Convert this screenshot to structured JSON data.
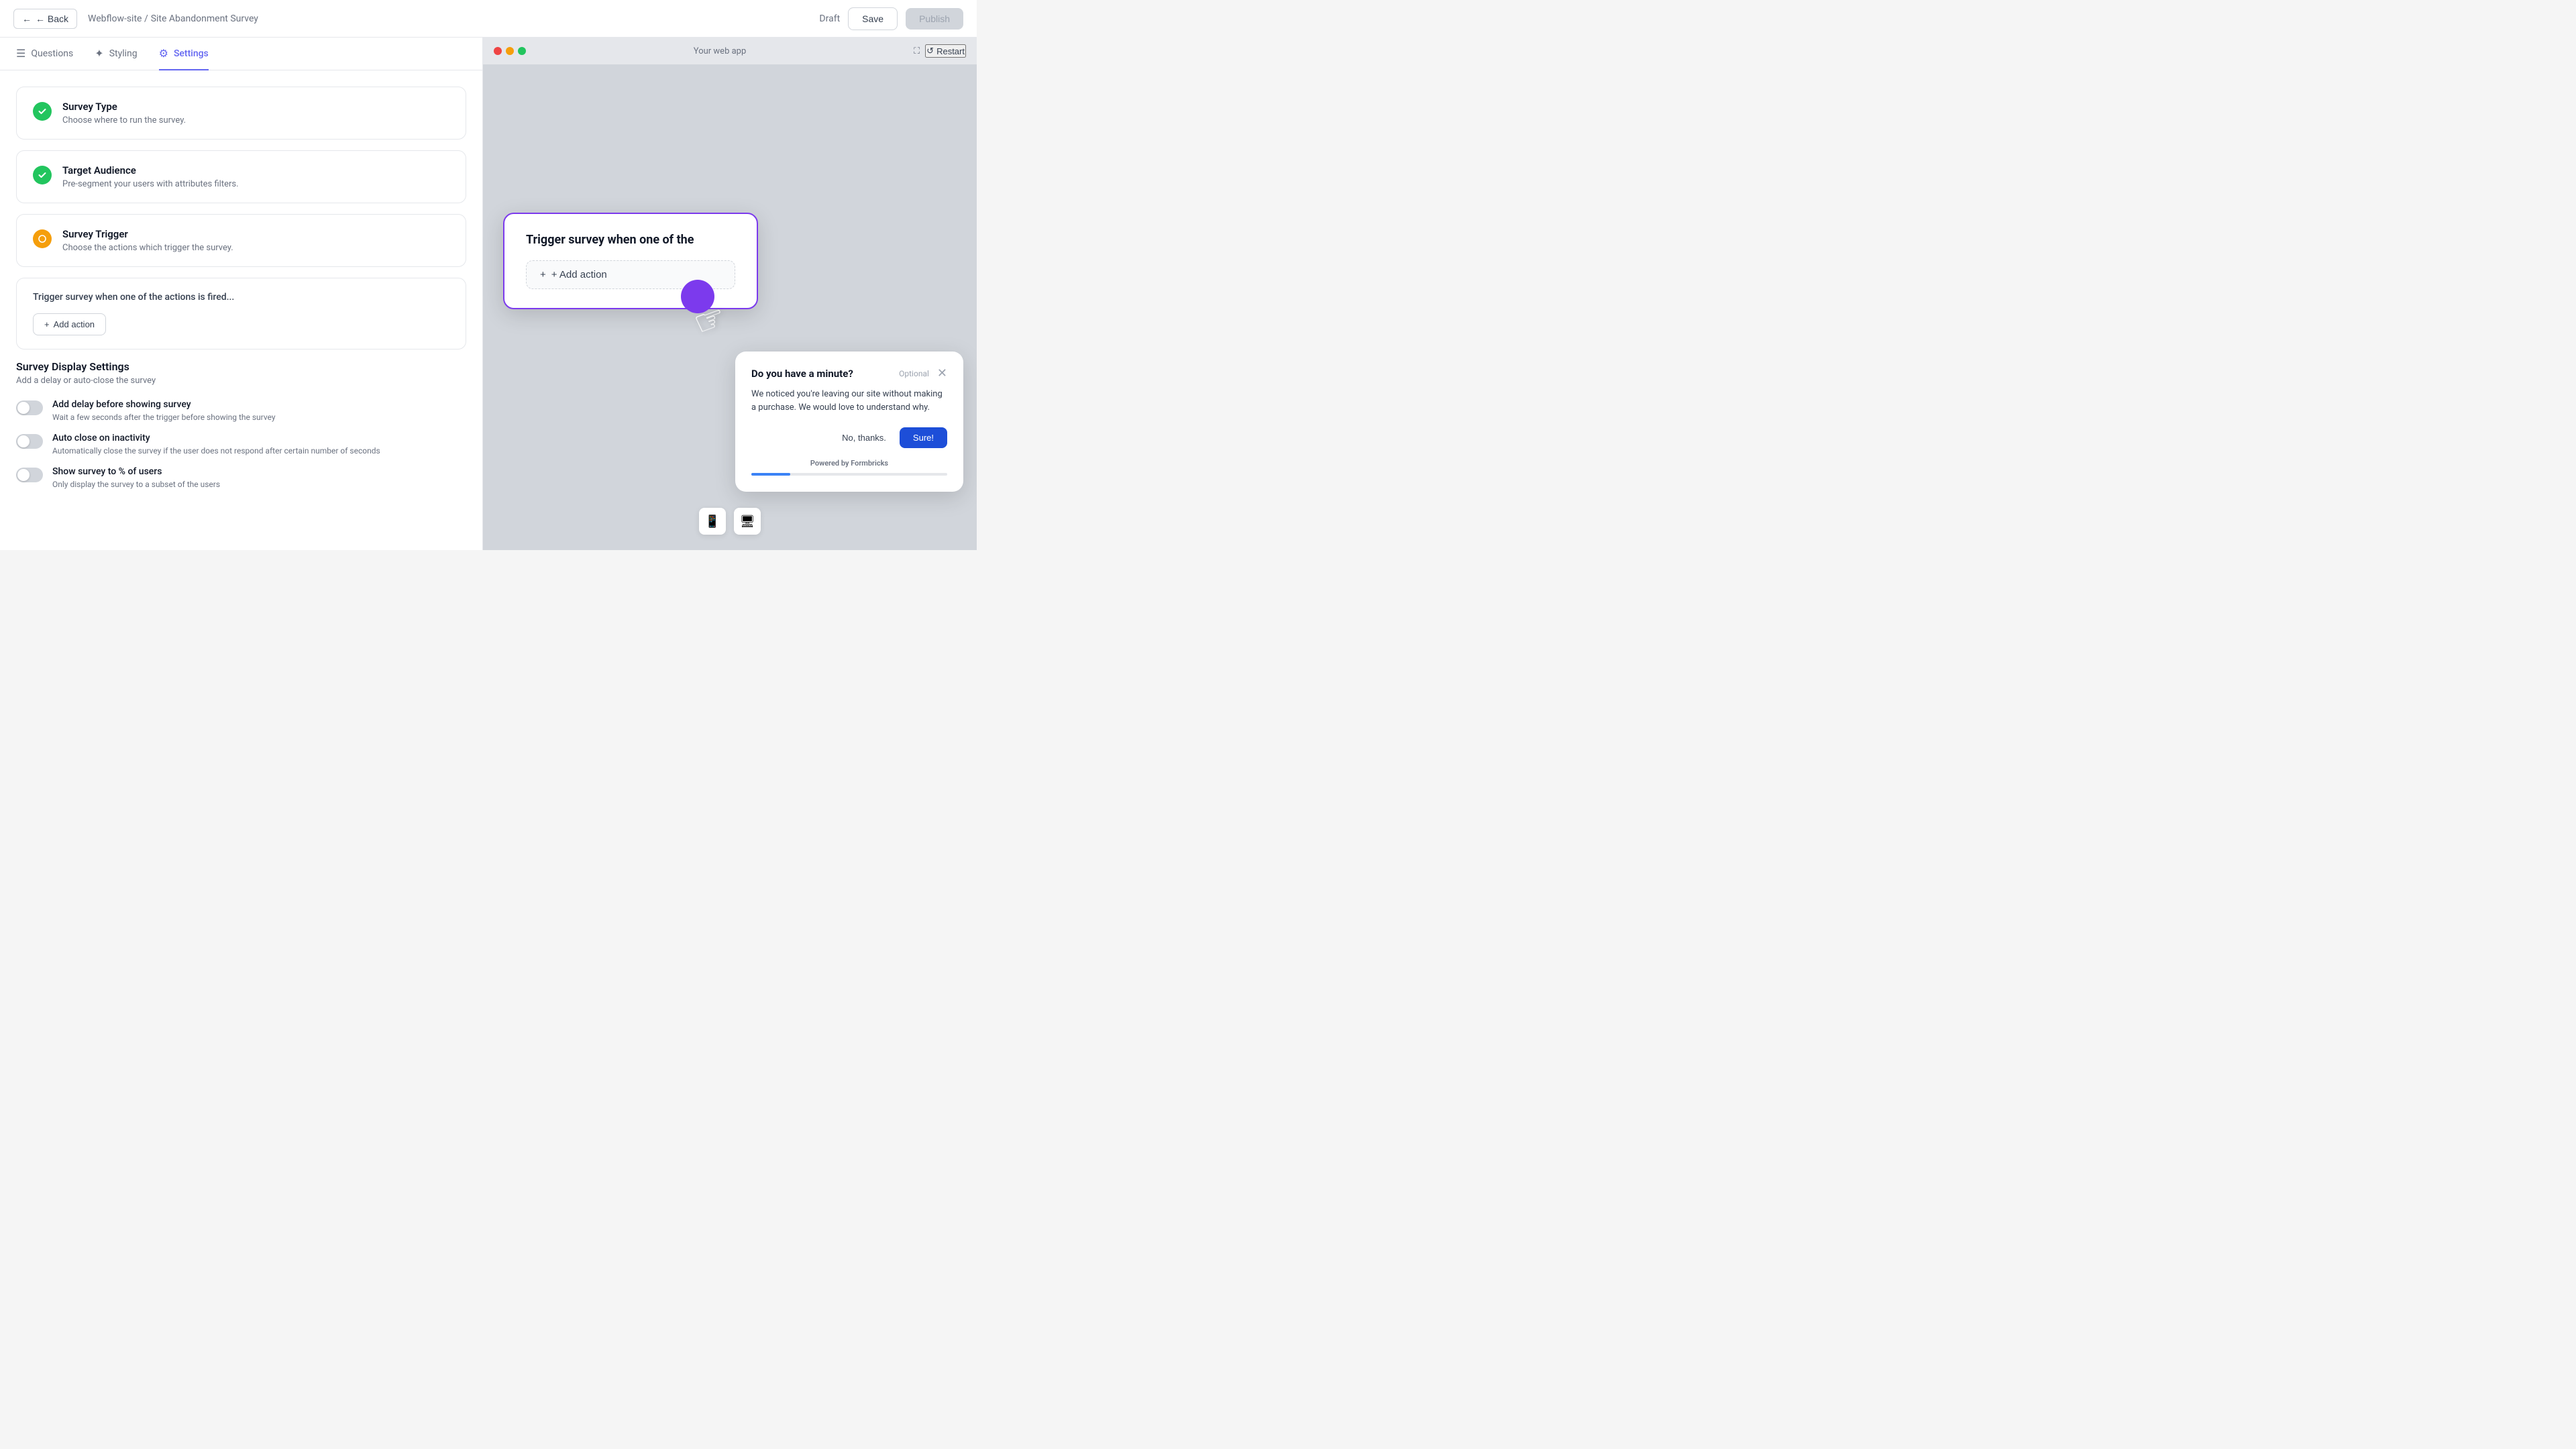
{
  "header": {
    "back_label": "← Back",
    "breadcrumb_parent": "Webflow-site /",
    "breadcrumb_current": "Site Abandonment Survey",
    "draft_label": "Draft",
    "save_label": "Save",
    "publish_label": "Publish"
  },
  "tabs": [
    {
      "id": "questions",
      "label": "Questions",
      "icon": "☰"
    },
    {
      "id": "styling",
      "label": "Styling",
      "icon": "✦"
    },
    {
      "id": "settings",
      "label": "Settings",
      "icon": "⚙"
    }
  ],
  "settings": {
    "survey_type": {
      "title": "Survey Type",
      "description": "Choose where to run the survey.",
      "status": "complete"
    },
    "target_audience": {
      "title": "Target Audience",
      "description": "Pre-segment your users with attributes filters.",
      "status": "complete"
    },
    "survey_trigger": {
      "title": "Survey Trigger",
      "description": "Choose the actions which trigger the survey.",
      "status": "pending"
    }
  },
  "trigger": {
    "label": "Trigger survey when one of the actions is fired...",
    "add_action_label": "+ Add action"
  },
  "display_settings": {
    "title": "Survey Display Settings",
    "subtitle": "Add a delay or auto-close the survey",
    "toggles": [
      {
        "title": "Add delay before showing survey",
        "description": "Wait a few seconds after the trigger before showing the survey"
      },
      {
        "title": "Auto close on inactivity",
        "description": "Automatically close the survey if the user does not respond after certain number of seconds"
      },
      {
        "title": "Show survey to % of users",
        "description": "Only display the survey to a subset of the users"
      }
    ]
  },
  "preview": {
    "browser_url": "Your web app",
    "restart_label": "Restart"
  },
  "tooltip": {
    "title": "Trigger survey when one of the",
    "add_btn_label": "+ Add action"
  },
  "survey_popup": {
    "title": "Do you have a minute?",
    "optional_label": "Optional",
    "body": "We noticed you're leaving our site without making a purchase. We would love to understand why.",
    "no_thanks_label": "No, thanks.",
    "sure_label": "Sure!",
    "powered_by": "Powered by",
    "brand": "Formbricks",
    "progress": 20
  }
}
